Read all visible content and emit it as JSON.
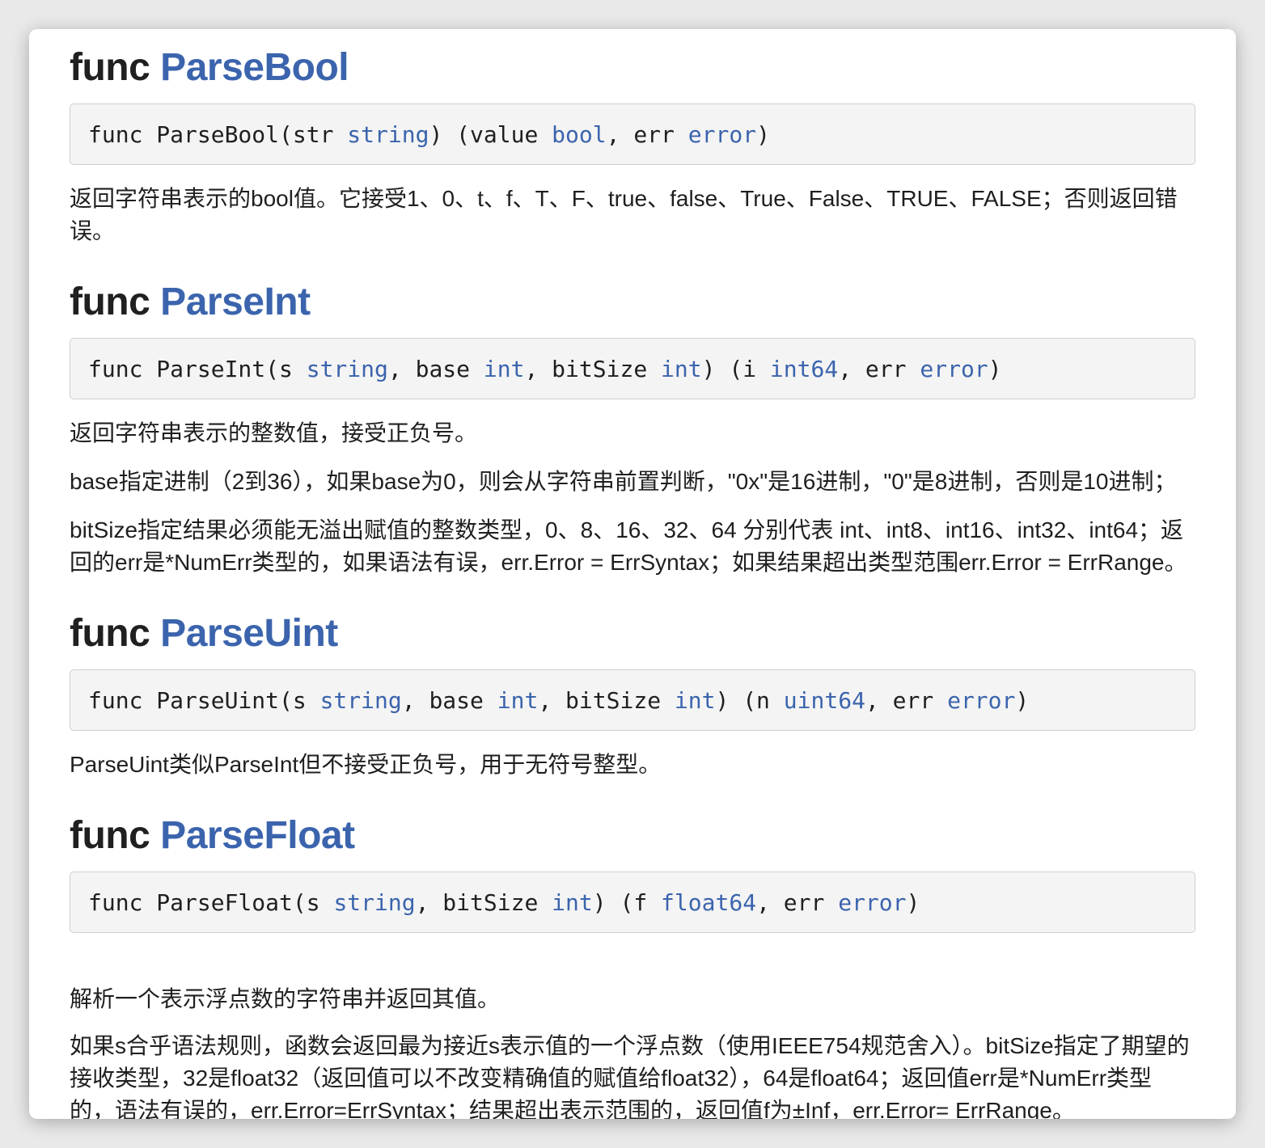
{
  "sections": [
    {
      "keyword": "func",
      "name": "ParseBool",
      "signature": {
        "prefix": "func ParseBool(str ",
        "t1": "string",
        "mid1": ") (value ",
        "t2": "bool",
        "mid2": ", err ",
        "t3": "error",
        "suffix": ")"
      },
      "paragraphs": [
        "返回字符串表示的bool值。它接受1、0、t、f、T、F、true、false、True、False、TRUE、FALSE；否则返回错误。"
      ]
    },
    {
      "keyword": "func",
      "name": "ParseInt",
      "signature": {
        "prefix": "func ParseInt(s ",
        "t1": "string",
        "mid1": ", base ",
        "t2": "int",
        "mid2": ", bitSize ",
        "t3": "int",
        "mid3": ") (i ",
        "t4": "int64",
        "mid4": ", err ",
        "t5": "error",
        "suffix": ")"
      },
      "paragraphs": [
        "返回字符串表示的整数值，接受正负号。",
        "base指定进制（2到36），如果base为0，则会从字符串前置判断，\"0x\"是16进制，\"0\"是8进制，否则是10进制；",
        "bitSize指定结果必须能无溢出赋值的整数类型，0、8、16、32、64 分别代表 int、int8、int16、int32、int64；返回的err是*NumErr类型的，如果语法有误，err.Error = ErrSyntax；如果结果超出类型范围err.Error = ErrRange。"
      ]
    },
    {
      "keyword": "func",
      "name": "ParseUint",
      "signature": {
        "prefix": "func ParseUint(s ",
        "t1": "string",
        "mid1": ", base ",
        "t2": "int",
        "mid2": ", bitSize ",
        "t3": "int",
        "mid3": ") (n ",
        "t4": "uint64",
        "mid4": ", err ",
        "t5": "error",
        "suffix": ")"
      },
      "paragraphs": [
        "ParseUint类似ParseInt但不接受正负号，用于无符号整型。"
      ]
    },
    {
      "keyword": "func",
      "name": "ParseFloat",
      "signature": {
        "prefix": "func ParseFloat(s ",
        "t1": "string",
        "mid1": ", bitSize ",
        "t2": "int",
        "mid2": ") (f ",
        "t3": "float64",
        "mid3": ", err ",
        "t4": "error",
        "suffix": ")"
      },
      "paragraphs": [
        "解析一个表示浮点数的字符串并返回其值。",
        "如果s合乎语法规则，函数会返回最为接近s表示值的一个浮点数（使用IEEE754规范舍入）。bitSize指定了期望的接收类型，32是float32（返回值可以不改变精确值的赋值给float32），64是float64；返回值err是*NumErr类型的，语法有误的，err.Error=ErrSyntax；结果超出表示范围的，返回值f为±Inf，err.Error= ErrRange。"
      ]
    }
  ]
}
